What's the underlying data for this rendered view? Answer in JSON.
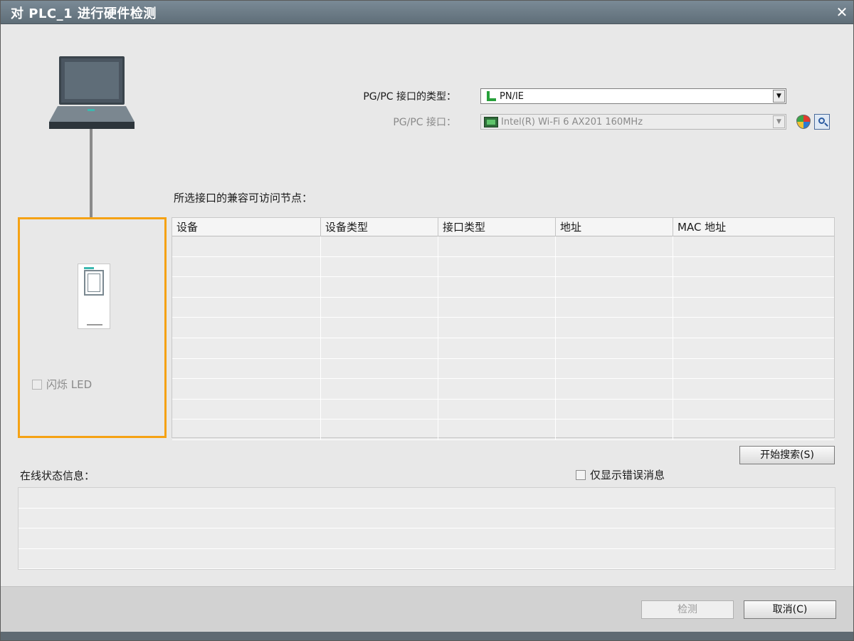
{
  "window": {
    "title": "对 PLC_1 进行硬件检测",
    "close_glyph": "✕"
  },
  "pgpc": {
    "type_label": "PG/PC 接口的类型：",
    "type_value": "PN/IE",
    "interface_label": "PG/PC 接口：",
    "interface_value": "Intel(R) Wi-Fi 6 AX201 160MHz"
  },
  "nodes": {
    "heading": "所选接口的兼容可访问节点：",
    "columns": [
      "设备",
      "设备类型",
      "接口类型",
      "地址",
      "MAC 地址"
    ],
    "row_count": 10
  },
  "led": {
    "label": "闪烁 LED",
    "checked": false
  },
  "search_button": "开始搜索(S)",
  "status": {
    "heading": "在线状态信息：",
    "errors_only_label": "仅显示错误消息",
    "errors_only_checked": false,
    "line_count": 4
  },
  "footer": {
    "detect_button": "检测",
    "cancel_button": "取消(C)"
  },
  "colors": {
    "highlight_border": "#f5a214",
    "titlebar": "#6a7882",
    "network_green": "#27a03a"
  },
  "icons": [
    "close-icon",
    "laptop-icon",
    "network-icon",
    "wifi-adapter-icon",
    "shield-icon",
    "diagnostics-icon",
    "plc-icon",
    "dropdown-arrow-icon"
  ]
}
